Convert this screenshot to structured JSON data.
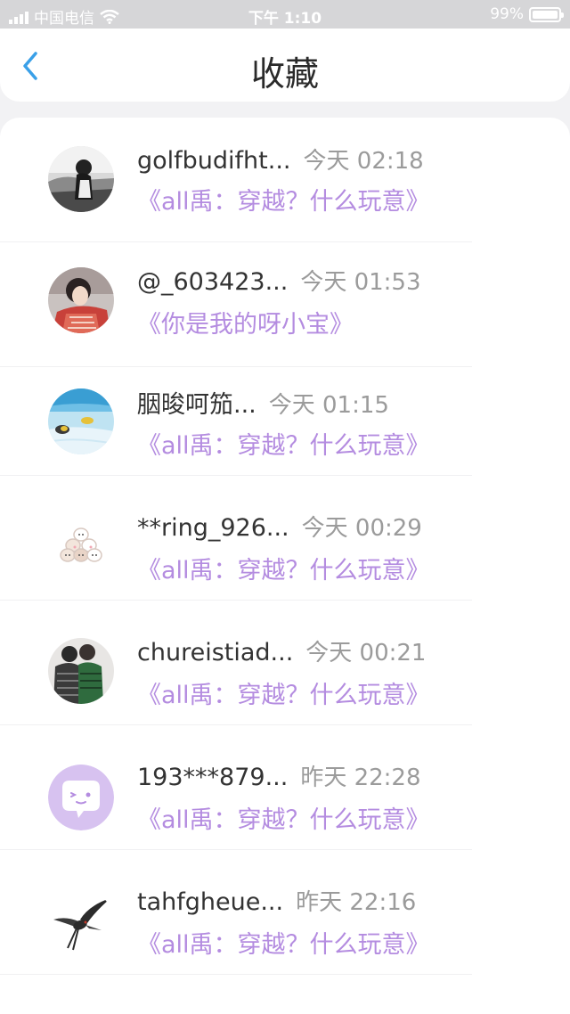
{
  "status_bar": {
    "carrier": "中国电信",
    "time": "下午 1:10",
    "battery": "99%",
    "battery_level": 0.99
  },
  "header": {
    "title": "收藏"
  },
  "colors": {
    "accent": "#3aa0e8",
    "work_title": "#b48ce0",
    "name": "#333333",
    "time": "#9b9b9b"
  },
  "items": [
    {
      "name": "golfbudifht...",
      "time": "今天 02:18",
      "work": "《all禹：穿越？什么玩意》",
      "avatar": "photo-girl-bw"
    },
    {
      "name": "@_603423...",
      "time": "今天 01:53",
      "work": "《你是我的呀小宝》",
      "avatar": "photo-red-scarf"
    },
    {
      "name": "胭晙呵笳...",
      "time": "今天 01:15",
      "work": "《all禹：穿越？什么玩意》",
      "avatar": "photo-fish"
    },
    {
      "name": "**ring_926...",
      "time": "今天 00:29",
      "work": "《all禹：穿越？什么玩意》",
      "avatar": "cartoon-cats"
    },
    {
      "name": "chureistiad...",
      "time": "今天 00:21",
      "work": "《all禹：穿越？什么玩意》",
      "avatar": "photo-couple"
    },
    {
      "name": "193***879...",
      "time": "昨天 22:28",
      "work": "《all禹：穿越？什么玩意》",
      "avatar": "default-chat-face"
    },
    {
      "name": "tahfgheue...",
      "time": "昨天 22:16",
      "work": "《all禹：穿越？什么玩意》",
      "avatar": "swallow-bird"
    }
  ]
}
